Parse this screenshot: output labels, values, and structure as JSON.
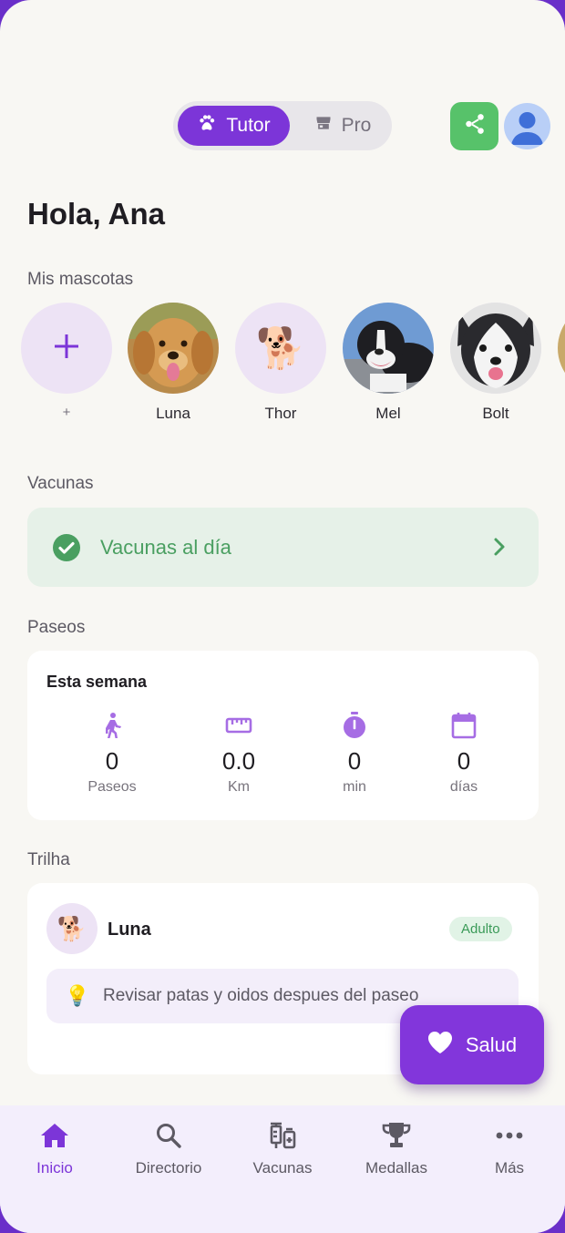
{
  "header": {
    "mode_toggle": {
      "tutor_label": "Tutor",
      "pro_label": "Pro",
      "selected": "Tutor"
    },
    "share_icon": "share-icon",
    "avatar_icon": "user-avatar"
  },
  "greeting": "Hola, Ana",
  "pets_section": {
    "label": "Mis mascotas",
    "add_label": "+",
    "add_symbol": "+",
    "pets": [
      {
        "name": "Luna",
        "kind": "golden-retriever-photo"
      },
      {
        "name": "Thor",
        "emoji": "🐕"
      },
      {
        "name": "Mel",
        "kind": "pitbull-photo"
      },
      {
        "name": "Bolt",
        "kind": "husky-photo"
      }
    ]
  },
  "vaccines_section": {
    "label": "Vacunas",
    "status_text": "Vacunas al día",
    "status_color": "#4a9f61"
  },
  "walks_section": {
    "label": "Paseos",
    "card_title": "Esta semana",
    "stats": [
      {
        "icon": "walk-icon",
        "value": "0",
        "unit": "Paseos"
      },
      {
        "icon": "ruler-icon",
        "value": "0.0",
        "unit": "Km"
      },
      {
        "icon": "timer-icon",
        "value": "0",
        "unit": "min"
      },
      {
        "icon": "calendar-icon",
        "value": "0",
        "unit": "días"
      }
    ]
  },
  "trail_section": {
    "label": "Trilha",
    "pet_emoji": "🐕",
    "pet_name": "Luna",
    "badge": "Adulto",
    "tip_icon": "💡",
    "tip_text": "Revisar patas y oidos despues del paseo"
  },
  "fab": {
    "label": "Salud",
    "icon": "heart-icon"
  },
  "bottom_nav": {
    "items": [
      {
        "label": "Inicio",
        "icon": "home-icon",
        "active": true
      },
      {
        "label": "Directorio",
        "icon": "search-icon",
        "active": false
      },
      {
        "label": "Vacunas",
        "icon": "vaccine-icon",
        "active": false
      },
      {
        "label": "Medallas",
        "icon": "trophy-icon",
        "active": false
      },
      {
        "label": "Más",
        "icon": "more-icon",
        "active": false
      }
    ]
  },
  "colors": {
    "accent": "#7c35d8",
    "success": "#57c26a",
    "background": "#f8f7f3",
    "nav_background": "#f3eefc"
  }
}
